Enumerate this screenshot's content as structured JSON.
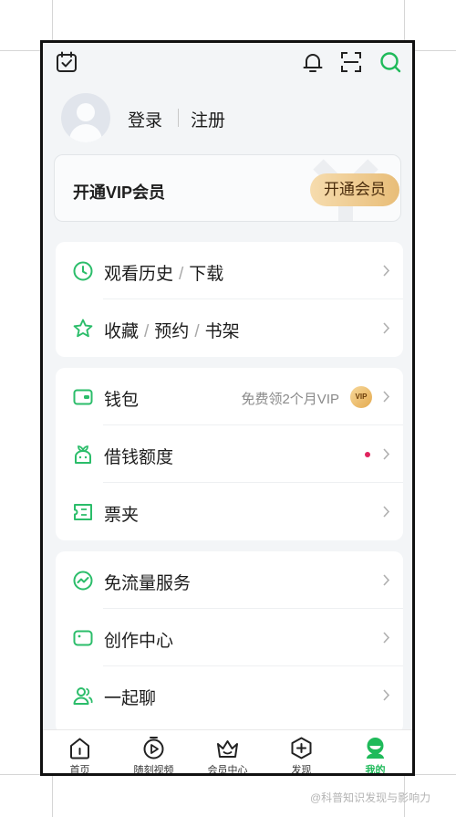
{
  "profile": {
    "login_label": "登录",
    "register_label": "注册"
  },
  "vip": {
    "title": "开通VIP会员",
    "button_label": "开通会员"
  },
  "group1": [
    {
      "parts": [
        "观看历史",
        "下载"
      ],
      "icon": "clock-icon"
    },
    {
      "parts": [
        "收藏",
        "预约",
        "书架"
      ],
      "icon": "star-icon"
    }
  ],
  "group2": [
    {
      "label": "钱包",
      "icon": "wallet-icon",
      "extra": "免费领2个月VIP",
      "badge": "VIP"
    },
    {
      "label": "借钱额度",
      "icon": "sprout-icon",
      "red_dot": true
    },
    {
      "label": "票夹",
      "icon": "ticket-icon"
    }
  ],
  "group3": [
    {
      "label": "免流量服务",
      "icon": "traffic-icon"
    },
    {
      "label": "创作中心",
      "icon": "camera-icon"
    },
    {
      "label": "一起聊",
      "icon": "people-icon"
    }
  ],
  "nav": [
    {
      "label": "首页",
      "icon": "home-icon"
    },
    {
      "label": "随刻视频",
      "icon": "play-icon"
    },
    {
      "label": "会员中心",
      "icon": "crown-icon"
    },
    {
      "label": "发现",
      "icon": "plus-icon"
    },
    {
      "label": "我的",
      "icon": "profile-icon",
      "active": true
    }
  ],
  "watermark": "@科普知识发现与影响力",
  "colors": {
    "accent": "#1fba5a",
    "icon_green": "#2bbd6a",
    "vip_gold": "#e8bd78",
    "page_bg": "#f3f5f7"
  }
}
